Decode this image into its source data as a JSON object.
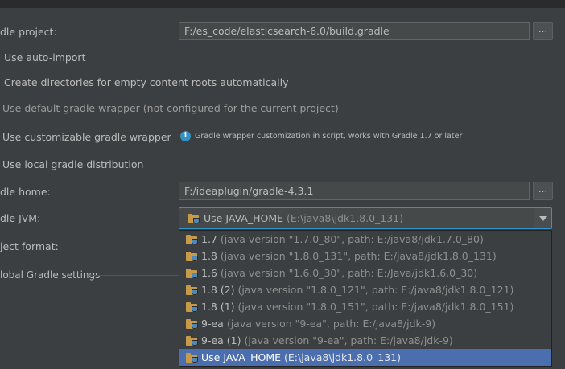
{
  "settings": {
    "project_label": "dle project:",
    "project_path": "F:/es_code/elasticsearch-6.0/build.gradle",
    "browse_label": "...",
    "auto_import": "Use auto-import",
    "create_dirs": "Create directories for empty content roots automatically",
    "default_wrapper": "Use default gradle wrapper (not configured for the current project)",
    "custom_wrapper": "Use customizable gradle wrapper",
    "wrapper_hint": "Gradle wrapper customization in script, works with Gradle 1.7 or later",
    "local_dist": "Use local gradle distribution",
    "home_label": "dle home:",
    "home_path": "F:/ideaplugin/gradle-4.3.1",
    "jvm_label": "dle JVM:",
    "jvm_selected_name": "Use JAVA_HOME",
    "jvm_selected_detail": "(E:\\java8\\jdk1.8.0_131)",
    "format_label": "ject format:",
    "global_label": "lobal Gradle settings"
  },
  "jvm_options": [
    {
      "name": "1.7",
      "detail": "(java version \"1.7.0_80\", path: E:/java8/jdk1.7.0_80)"
    },
    {
      "name": "1.8",
      "detail": "(java version \"1.8.0_131\", path: E:/java8/jdk1.8.0_131)"
    },
    {
      "name": "1.6",
      "detail": "(java version \"1.6.0_30\", path: E:/Java/jdk1.6.0_30)"
    },
    {
      "name": "1.8 (2)",
      "detail": "(java version \"1.8.0_121\", path: E:/java8/jdk1.8.0_121)"
    },
    {
      "name": "1.8 (1)",
      "detail": "(java version \"1.8.0_151\", path: E:/java8/jdk1.8.0_151)"
    },
    {
      "name": "9-ea",
      "detail": "(java version \"9-ea\", path: E:/java8/jdk-9)"
    },
    {
      "name": "9-ea (1)",
      "detail": "(java version \"9-ea\", path: E:/java8/jdk-9)"
    },
    {
      "name": "Use JAVA_HOME",
      "detail": "(E:\\java8\\jdk1.8.0_131)"
    }
  ],
  "colors": {
    "background": "#3c3f41",
    "selection": "#4b6eaf",
    "focus_border": "#3592c4"
  }
}
